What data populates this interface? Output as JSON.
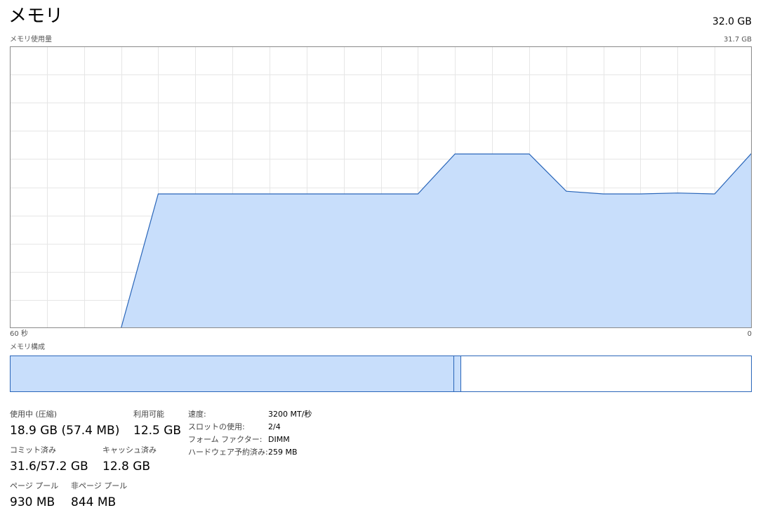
{
  "header": {
    "title": "メモリ",
    "total": "32.0 GB"
  },
  "usage_chart": {
    "label": "メモリ使用量",
    "max_label": "31.7 GB",
    "time_left_label": "60 秒",
    "time_right_label": "0",
    "colors": {
      "line": "#2a66b9",
      "fill": "#c8defb",
      "grid": "#e6e6e6",
      "border": "#8a8a8a"
    }
  },
  "chart_data": {
    "type": "area",
    "x": [
      60,
      57,
      54,
      51,
      48,
      45,
      42,
      39,
      36,
      33,
      30,
      27,
      24,
      21,
      18,
      15,
      12,
      9,
      6,
      3,
      0
    ],
    "y": [
      0,
      0,
      0,
      0,
      15.1,
      15.1,
      15.1,
      15.1,
      15.1,
      15.1,
      15.1,
      15.1,
      19.6,
      19.6,
      19.6,
      15.4,
      15.1,
      15.1,
      15.2,
      15.1,
      19.7
    ],
    "xlim": [
      60,
      0
    ],
    "ylim": [
      0,
      31.7
    ]
  },
  "composition": {
    "label": "メモリ構成",
    "in_use_fraction": 0.598,
    "modified_fraction": 0.009
  },
  "stats": {
    "in_use_label": "使用中 (圧縮)",
    "in_use_value": "18.9 GB (57.4 MB)",
    "available_label": "利用可能",
    "available_value": "12.5 GB",
    "committed_label": "コミット済み",
    "committed_value": "31.6/57.2 GB",
    "cached_label": "キャッシュ済み",
    "cached_value": "12.8 GB",
    "paged_label": "ページ プール",
    "paged_value": "930 MB",
    "nonpaged_label": "非ページ プール",
    "nonpaged_value": "844 MB"
  },
  "properties": [
    {
      "label": "速度:",
      "value": "3200 MT/秒"
    },
    {
      "label": "スロットの使用:",
      "value": "2/4"
    },
    {
      "label": "フォーム ファクター:",
      "value": "DIMM"
    },
    {
      "label": "ハードウェア予約済み:",
      "value": "259 MB"
    }
  ]
}
